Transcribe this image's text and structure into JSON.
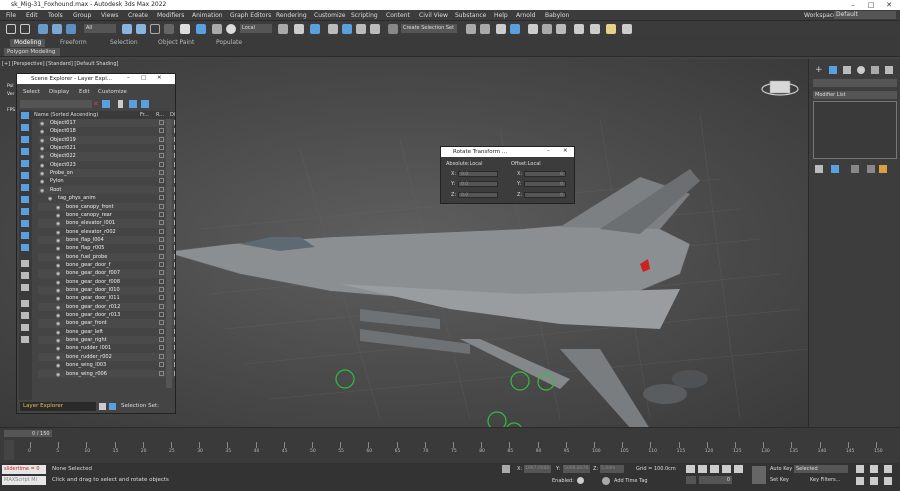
{
  "window": {
    "title": "sk_Mig-31_Foxhound.max - Autodesk 3ds Max 2022"
  },
  "menu": [
    "File",
    "Edit",
    "Tools",
    "Group",
    "Views",
    "Create",
    "Modifiers",
    "Animation",
    "Graph Editors",
    "Rendering",
    "Customize",
    "Scripting",
    "Content",
    "Civil View",
    "Substance",
    "Help",
    "Arnold",
    "Babylon"
  ],
  "workspaces": {
    "label": "Workspaces:",
    "value": "Default"
  },
  "toolbar": {
    "filter": "All",
    "refcoord": "Local",
    "selset": "Create Selection Set"
  },
  "ribbon": {
    "tabs": [
      "Modeling",
      "Freeform",
      "Selection",
      "Object Paint",
      "Populate"
    ],
    "sub": "Polygon Modeling"
  },
  "viewport": {
    "label": "[+] [Perspective] [Standard] [Default Shading]",
    "stats": [
      "Pol",
      "Ver",
      "FPS"
    ]
  },
  "explorer": {
    "title": "Scene Explorer - Layer Expl...",
    "menu": [
      "Select",
      "Display",
      "Edit",
      "Customize"
    ],
    "col_name": "Name (Sorted Ascending)",
    "col_fr": "Fr...",
    "col_r": "R...",
    "col_d": "Di",
    "rows": [
      {
        "name": "Object017",
        "indent": 0
      },
      {
        "name": "Object018",
        "indent": 0
      },
      {
        "name": "Object019",
        "indent": 0
      },
      {
        "name": "Object021",
        "indent": 0
      },
      {
        "name": "Object022",
        "indent": 0
      },
      {
        "name": "Object023",
        "indent": 0
      },
      {
        "name": "Probe_on",
        "indent": 0
      },
      {
        "name": "Pylon",
        "indent": 0
      },
      {
        "name": "Root",
        "indent": 0
      },
      {
        "name": "tag_phys_anim",
        "indent": 1
      },
      {
        "name": "bone_canopy_front",
        "indent": 2
      },
      {
        "name": "bone_canopy_rear",
        "indent": 2
      },
      {
        "name": "bone_elevator_l001",
        "indent": 2
      },
      {
        "name": "bone_elevator_r002",
        "indent": 2
      },
      {
        "name": "bone_flap_l004",
        "indent": 2
      },
      {
        "name": "bone_flap_r005",
        "indent": 2
      },
      {
        "name": "bone_fuel_probe",
        "indent": 2
      },
      {
        "name": "bone_gear_door_f",
        "indent": 2
      },
      {
        "name": "bone_gear_door_f007",
        "indent": 2
      },
      {
        "name": "bone_gear_door_f008",
        "indent": 2
      },
      {
        "name": "bone_gear_door_l010",
        "indent": 2
      },
      {
        "name": "bone_gear_door_l011",
        "indent": 2
      },
      {
        "name": "bone_gear_door_r012",
        "indent": 2
      },
      {
        "name": "bone_gear_door_r013",
        "indent": 2
      },
      {
        "name": "bone_gear_front",
        "indent": 2
      },
      {
        "name": "bone_gear_left",
        "indent": 2
      },
      {
        "name": "bone_gear_right",
        "indent": 2
      },
      {
        "name": "bone_rudder_l001",
        "indent": 2
      },
      {
        "name": "bone_rudder_r002",
        "indent": 2
      },
      {
        "name": "bone_wing_l003",
        "indent": 2
      },
      {
        "name": "bone_wing_r006",
        "indent": 2
      }
    ],
    "layer_dropdown": "Layer Explorer",
    "selection_set": "Selection Set:"
  },
  "rotate_dialog": {
    "title": "Rotate Transform ...",
    "abs": "Absolute:Local",
    "off": "Offset:Local",
    "abs_fields": [
      {
        "label": "X:",
        "value": "0.0"
      },
      {
        "label": "Y:",
        "value": "0.0"
      },
      {
        "label": "Z:",
        "value": "0.0"
      }
    ],
    "off_fields": [
      {
        "label": "X:",
        "value": "0"
      },
      {
        "label": "Y:",
        "value": "0"
      },
      {
        "label": "Z:",
        "value": "0"
      }
    ]
  },
  "cmdpanel": {
    "modlist": "Modifier List"
  },
  "timeline": {
    "frame": "0 / 150",
    "ticks": [
      "0",
      "5",
      "10",
      "15",
      "20",
      "25",
      "30",
      "35",
      "40",
      "45",
      "50",
      "55",
      "60",
      "65",
      "70",
      "75",
      "80",
      "85",
      "90",
      "95",
      "100",
      "105",
      "110",
      "115",
      "120",
      "125",
      "130",
      "135",
      "140",
      "145",
      "150"
    ]
  },
  "status": {
    "script": "slidertime = 0",
    "script2": "MAXScript Mi",
    "none_selected": "None Selected",
    "hint": "Click and drag to select and rotate objects",
    "x": "X:",
    "y": "Y:",
    "z": "Z:",
    "xval": "1997.0000",
    "yval": "5008.8076",
    "zval": "5.0dm",
    "grid": "Grid = 100.0cm",
    "enabled": "Enabled:",
    "addtimetag": "Add Time Tag",
    "autokey": "Auto Key",
    "selected": "Selected",
    "setkey": "Set Key",
    "keyfilters": "Key Filters...",
    "frame": "0"
  },
  "colors": {
    "accent": "#5aa0e0",
    "bg": "#444444",
    "panel": "#3c3c3c"
  }
}
